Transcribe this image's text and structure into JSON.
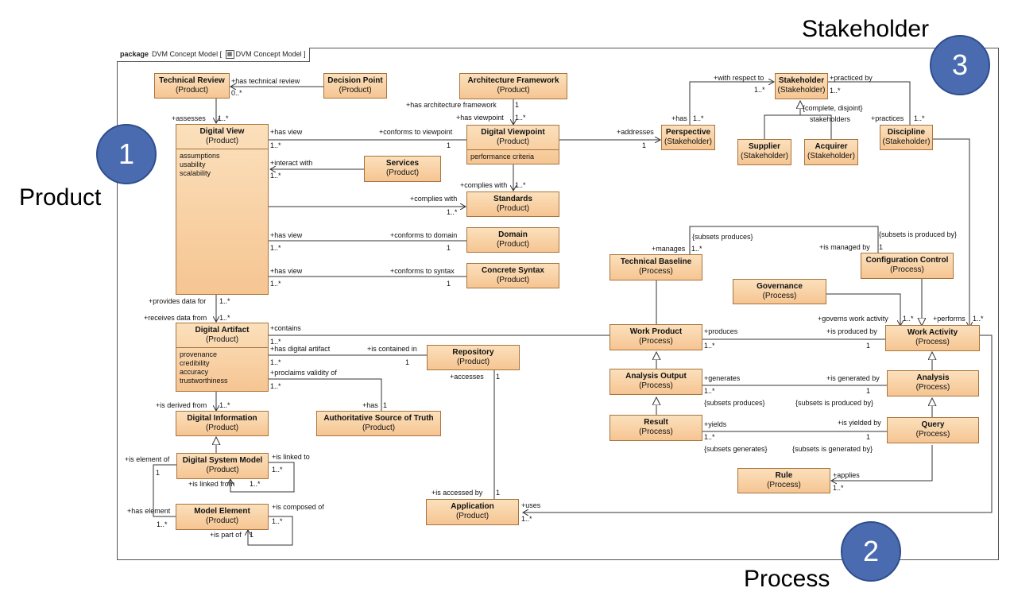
{
  "package": {
    "keyword": "package",
    "name": "DVM Concept Model",
    "frame_ref": "DVM Concept Model"
  },
  "region_labels": {
    "product": "Product",
    "process": "Process",
    "stakeholder": "Stakeholder"
  },
  "badges": {
    "one": "1",
    "two": "2",
    "three": "3"
  },
  "icons": {
    "frame_ref_icon": "diagram-icon"
  },
  "colors": {
    "class_fill_top": "#fbe0bc",
    "class_fill_bottom": "#f6c592",
    "class_border": "#a8743c",
    "badge": "#4a6bb0"
  },
  "classes": {
    "technical_review": {
      "name": "Technical Review",
      "stereotype": "(Product)"
    },
    "decision_point": {
      "name": "Decision Point",
      "stereotype": "(Product)"
    },
    "architecture_framework": {
      "name": "Architecture Framework",
      "stereotype": "(Product)"
    },
    "digital_view": {
      "name": "Digital View",
      "stereotype": "(Product)",
      "attributes": [
        "assumptions",
        "usability",
        "scalability"
      ]
    },
    "digital_viewpoint": {
      "name": "Digital Viewpoint",
      "stereotype": "(Product)",
      "attributes": [
        "performance criteria"
      ]
    },
    "services": {
      "name": "Services",
      "stereotype": "(Product)"
    },
    "standards": {
      "name": "Standards",
      "stereotype": "(Product)"
    },
    "domain": {
      "name": "Domain",
      "stereotype": "(Product)"
    },
    "concrete_syntax": {
      "name": "Concrete Syntax",
      "stereotype": "(Product)"
    },
    "digital_artifact": {
      "name": "Digital Artifact",
      "stereotype": "(Product)",
      "attributes": [
        "provenance",
        "credibility",
        "accuracy",
        "trustworthiness"
      ]
    },
    "repository": {
      "name": "Repository",
      "stereotype": "(Product)"
    },
    "authoritative_source": {
      "name": "Authoritative Source of Truth",
      "stereotype": "(Product)"
    },
    "digital_information": {
      "name": "Digital Information",
      "stereotype": "(Product)"
    },
    "digital_system_model": {
      "name": "Digital System Model",
      "stereotype": "(Product)"
    },
    "model_element": {
      "name": "Model Element",
      "stereotype": "(Product)"
    },
    "application": {
      "name": "Application",
      "stereotype": "(Product)"
    },
    "stakeholder": {
      "name": "Stakeholder",
      "stereotype": "(Stakeholder)"
    },
    "perspective": {
      "name": "Perspective",
      "stereotype": "(Stakeholder)"
    },
    "supplier": {
      "name": "Supplier",
      "stereotype": "(Stakeholder)"
    },
    "acquirer": {
      "name": "Acquirer",
      "stereotype": "(Stakeholder)"
    },
    "discipline": {
      "name": "Discipline",
      "stereotype": "(Stakeholder)"
    },
    "technical_baseline": {
      "name": "Technical Baseline",
      "stereotype": "(Process)"
    },
    "configuration_control": {
      "name": "Configuration Control",
      "stereotype": "(Process)"
    },
    "governance": {
      "name": "Governance",
      "stereotype": "(Process)"
    },
    "work_product": {
      "name": "Work Product",
      "stereotype": "(Process)"
    },
    "work_activity": {
      "name": "Work Activity",
      "stereotype": "(Process)"
    },
    "analysis_output": {
      "name": "Analysis Output",
      "stereotype": "(Process)"
    },
    "analysis": {
      "name": "Analysis",
      "stereotype": "(Process)"
    },
    "result": {
      "name": "Result",
      "stereotype": "(Process)"
    },
    "query": {
      "name": "Query",
      "stereotype": "(Process)"
    },
    "rule": {
      "name": "Rule",
      "stereotype": "(Process)"
    }
  },
  "labels": [
    {
      "id": "l1",
      "text": "+has technical review"
    },
    {
      "id": "l2",
      "text": "0..*"
    },
    {
      "id": "l3",
      "text": "+assesses"
    },
    {
      "id": "l4",
      "text": "1..*"
    },
    {
      "id": "l5",
      "text": "+has architecture framework"
    },
    {
      "id": "l6",
      "text": "1"
    },
    {
      "id": "l7",
      "text": "+has viewpoint"
    },
    {
      "id": "l8",
      "text": "1..*"
    },
    {
      "id": "l9",
      "text": "+has view"
    },
    {
      "id": "l10",
      "text": "1..*"
    },
    {
      "id": "l11",
      "text": "+conforms to viewpoint"
    },
    {
      "id": "l12",
      "text": "1"
    },
    {
      "id": "l13",
      "text": "+interact with"
    },
    {
      "id": "l14",
      "text": "1..*"
    },
    {
      "id": "l15",
      "text": "+complies with"
    },
    {
      "id": "l16",
      "text": "1..*"
    },
    {
      "id": "l17",
      "text": "+complies with"
    },
    {
      "id": "l18",
      "text": "1..*"
    },
    {
      "id": "l19",
      "text": "+has view"
    },
    {
      "id": "l20",
      "text": "1..*"
    },
    {
      "id": "l21",
      "text": "+conforms to domain"
    },
    {
      "id": "l22",
      "text": "1"
    },
    {
      "id": "l23",
      "text": "+has view"
    },
    {
      "id": "l24",
      "text": "1..*"
    },
    {
      "id": "l25",
      "text": "+conforms to syntax"
    },
    {
      "id": "l26",
      "text": "1"
    },
    {
      "id": "l27",
      "text": "+provides data for"
    },
    {
      "id": "l28",
      "text": "1..*"
    },
    {
      "id": "l29",
      "text": "+receives data from"
    },
    {
      "id": "l30",
      "text": "1..*"
    },
    {
      "id": "l31",
      "text": "+contains"
    },
    {
      "id": "l32",
      "text": "1..*"
    },
    {
      "id": "l33",
      "text": "+has digital artifact"
    },
    {
      "id": "l34",
      "text": "1..*"
    },
    {
      "id": "l35",
      "text": "+is contained in"
    },
    {
      "id": "l36",
      "text": "1"
    },
    {
      "id": "l37",
      "text": "+proclaims validity of"
    },
    {
      "id": "l38",
      "text": "1..*"
    },
    {
      "id": "l39",
      "text": "+accesses"
    },
    {
      "id": "l40",
      "text": "1"
    },
    {
      "id": "l41",
      "text": "+has"
    },
    {
      "id": "l42",
      "text": "1"
    },
    {
      "id": "l43",
      "text": "+is derived from"
    },
    {
      "id": "l44",
      "text": "1..*"
    },
    {
      "id": "l45",
      "text": "+is element of"
    },
    {
      "id": "l46",
      "text": "1"
    },
    {
      "id": "l47",
      "text": "+is linked to"
    },
    {
      "id": "l48",
      "text": "1..*"
    },
    {
      "id": "l49",
      "text": "+is linked from"
    },
    {
      "id": "l50",
      "text": "1..*"
    },
    {
      "id": "l51",
      "text": "+has element"
    },
    {
      "id": "l52",
      "text": "1..*"
    },
    {
      "id": "l53",
      "text": "+is composed of"
    },
    {
      "id": "l54",
      "text": "1..*"
    },
    {
      "id": "l55",
      "text": "+is part of"
    },
    {
      "id": "l56",
      "text": "1"
    },
    {
      "id": "l57",
      "text": "+is accessed by"
    },
    {
      "id": "l58",
      "text": "1"
    },
    {
      "id": "l59",
      "text": "+uses"
    },
    {
      "id": "l60",
      "text": "1..*"
    },
    {
      "id": "l61",
      "text": "+with respect to"
    },
    {
      "id": "l62",
      "text": "1..*"
    },
    {
      "id": "l63",
      "text": "+practiced by"
    },
    {
      "id": "l64",
      "text": "1..*"
    },
    {
      "id": "l65",
      "text": "{complete, disjoint}"
    },
    {
      "id": "l66",
      "text": "stakeholders"
    },
    {
      "id": "l67",
      "text": "+has"
    },
    {
      "id": "l68",
      "text": "1..*"
    },
    {
      "id": "l69",
      "text": "+addresses"
    },
    {
      "id": "l70",
      "text": "1"
    },
    {
      "id": "l71",
      "text": "+practices"
    },
    {
      "id": "l72",
      "text": "1..*"
    },
    {
      "id": "l73",
      "text": "{subsets produces}"
    },
    {
      "id": "l74",
      "text": "{subsets is produced by}"
    },
    {
      "id": "l75",
      "text": "+manages"
    },
    {
      "id": "l76",
      "text": "1..*"
    },
    {
      "id": "l77",
      "text": "+is managed by"
    },
    {
      "id": "l78",
      "text": "1"
    },
    {
      "id": "l79",
      "text": "+governs work activity"
    },
    {
      "id": "l80",
      "text": "1..*"
    },
    {
      "id": "l81",
      "text": "+performs"
    },
    {
      "id": "l82",
      "text": "1..*"
    },
    {
      "id": "l83",
      "text": "+produces"
    },
    {
      "id": "l84",
      "text": "1..*"
    },
    {
      "id": "l85",
      "text": "+is produced by"
    },
    {
      "id": "l86",
      "text": "1"
    },
    {
      "id": "l87",
      "text": "+generates"
    },
    {
      "id": "l88",
      "text": "1..*"
    },
    {
      "id": "l89",
      "text": "+is generated by"
    },
    {
      "id": "l90",
      "text": "1"
    },
    {
      "id": "l91",
      "text": "{subsets produces}"
    },
    {
      "id": "l92",
      "text": "{subsets is produced by}"
    },
    {
      "id": "l93",
      "text": "+yields"
    },
    {
      "id": "l94",
      "text": "1..*"
    },
    {
      "id": "l95",
      "text": "+is yielded by"
    },
    {
      "id": "l96",
      "text": "1"
    },
    {
      "id": "l97",
      "text": "{subsets generates}"
    },
    {
      "id": "l98",
      "text": "{subsets is generated by}"
    },
    {
      "id": "l99",
      "text": "+applies"
    },
    {
      "id": "l100",
      "text": "1..*"
    }
  ]
}
